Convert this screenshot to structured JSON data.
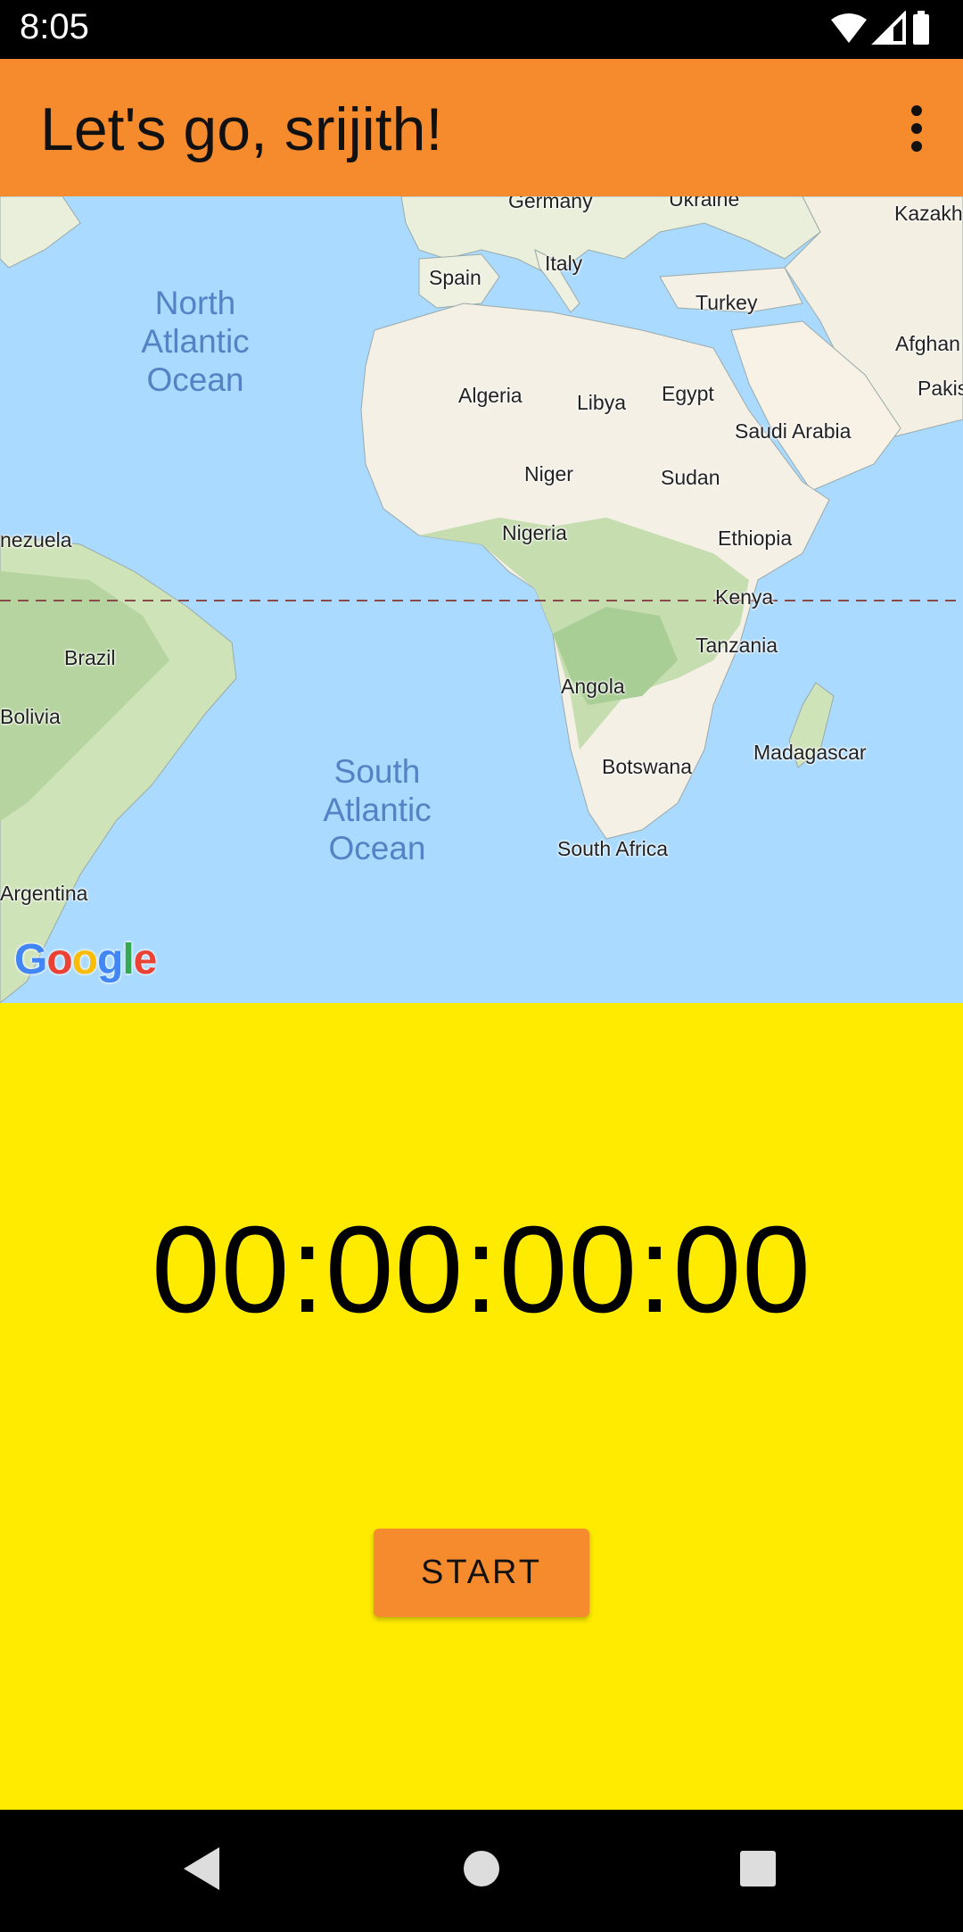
{
  "status_bar": {
    "time": "8:05",
    "icons": [
      "wifi-icon",
      "cellular-signal-icon",
      "battery-icon"
    ]
  },
  "app_bar": {
    "title": "Let's go, srijith!",
    "overflow_icon": "more-vertical-icon",
    "background_color": "#f68b2e"
  },
  "map": {
    "labels": {
      "germany": "Germany",
      "ukraine": "Ukraine",
      "kazakh": "Kazakh",
      "spain": "Spain",
      "italy": "Italy",
      "turkey": "Turkey",
      "afghan": "Afghan",
      "pakis": "Pakis",
      "algeria": "Algeria",
      "libya": "Libya",
      "egypt": "Egypt",
      "saudi_arabia": "Saudi Arabia",
      "niger": "Niger",
      "sudan": "Sudan",
      "venezuela": "nezuela",
      "nigeria": "Nigeria",
      "ethiopia": "Ethiopia",
      "kenya": "Kenya",
      "brazil": "Brazil",
      "tanzania": "Tanzania",
      "angola": "Angola",
      "bolivia": "Bolivia",
      "madagascar": "Madagascar",
      "botswana": "Botswana",
      "south_africa": "South Africa",
      "argentina": "Argentina"
    },
    "oceans": {
      "north_atlantic": [
        "North",
        "Atlantic",
        "Ocean"
      ],
      "south_atlantic": [
        "South",
        "Atlantic",
        "Ocean"
      ]
    },
    "logo": {
      "letters": [
        "G",
        "o",
        "o",
        "g",
        "l",
        "e"
      ],
      "colors": [
        "#4285f4",
        "#ea4335",
        "#fbbc05",
        "#4285f4",
        "#34a853",
        "#ea4335"
      ]
    },
    "water_color": "#aadaff",
    "land_color": "#f5f0e6",
    "vegetation_color": "#cfe3b8"
  },
  "timer": {
    "display": "00:00:00:00",
    "background_color": "#ffeb00"
  },
  "start_button": {
    "label": "START"
  },
  "nav_bar": {
    "icons": [
      "back-icon",
      "home-icon",
      "recents-icon"
    ]
  }
}
